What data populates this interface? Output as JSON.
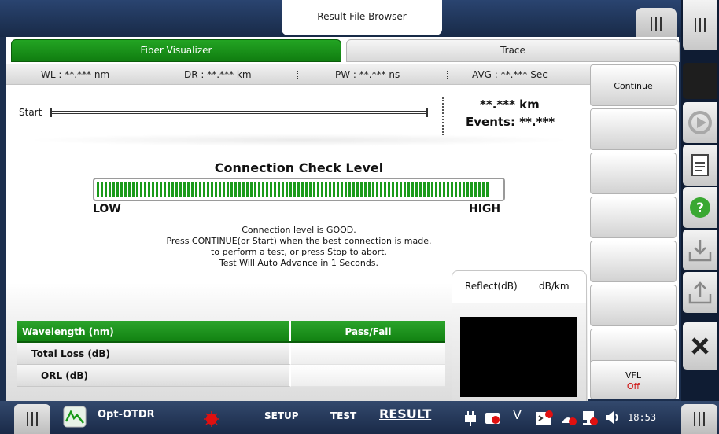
{
  "header": {
    "title": "Result File Browser"
  },
  "tabs": [
    {
      "label": "Fiber Visualizer",
      "active": true
    },
    {
      "label": "Trace",
      "active": false
    }
  ],
  "status": {
    "wl": "WL : **.*** nm",
    "dr": "DR : **.*** km",
    "pw": "PW : **.*** ns",
    "avg": "AVG : **.*** Sec"
  },
  "trace": {
    "start_label": "Start",
    "distance": "**.*** km",
    "events": "Events: **.***"
  },
  "connection": {
    "title": "Connection Check Level",
    "low_label": "LOW",
    "high_label": "HIGH",
    "level_fraction": 0.97,
    "messages": [
      "Connection level is GOOD.",
      "Press CONTINUE(or Start) when the best connection is made.",
      "to perform a test, or press Stop to abort.",
      "Test Will Auto Advance in 1 Seconds."
    ]
  },
  "results": {
    "header_col1": "Wavelength (nm)",
    "header_col2": "Pass/Fail",
    "rows": [
      {
        "label": "Total Loss (dB)",
        "value": ""
      },
      {
        "label": "ORL (dB)",
        "value": ""
      }
    ]
  },
  "reflect": {
    "col1": "Reflect(dB)",
    "col2": "dB/km"
  },
  "softkeys": {
    "continue": "Continue",
    "vfl_label": "VFL",
    "vfl_state": "Off"
  },
  "icons": [
    "menu-icon",
    "play-icon",
    "chart-report-icon",
    "document-icon",
    "help-icon",
    "load-icon",
    "save-icon",
    "close-icon"
  ],
  "taskbar": {
    "app_name": "Opt-OTDR",
    "setup": "SETUP",
    "test": "TEST",
    "result": "RESULT",
    "v_label": "V",
    "clock": "18:53"
  },
  "colors": {
    "accent_green": "#1a9a1a",
    "brand_dark": "#1c2f4e",
    "alert_red": "#e01010"
  }
}
